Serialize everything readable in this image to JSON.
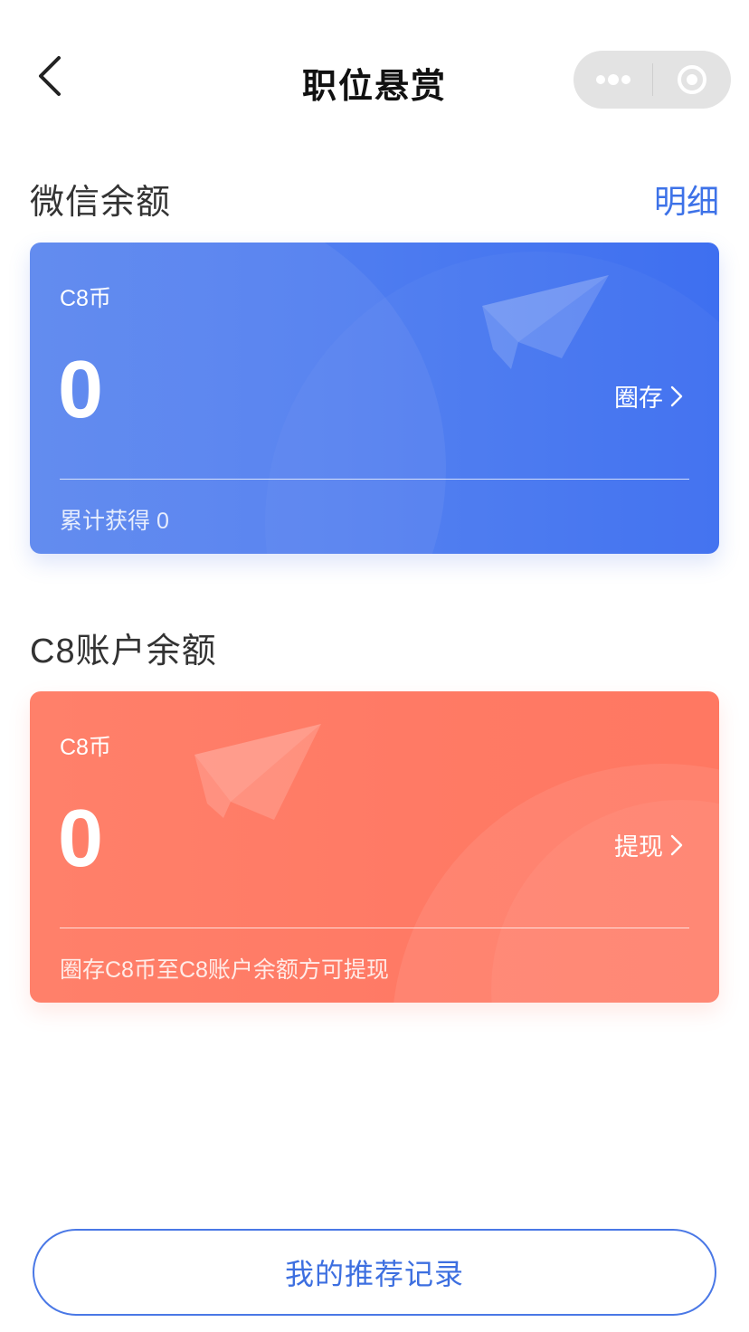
{
  "navbar": {
    "title": "职位悬赏",
    "back_icon": "chevron-left-icon",
    "more_icon": "more-dots-icon",
    "close_icon": "target-close-icon"
  },
  "wechat_section": {
    "title": "微信余额",
    "detail_link": "明细",
    "card": {
      "label": "C8币",
      "amount": "0",
      "action": "圈存",
      "footer": "累计获得 0",
      "color": "#4f7df0"
    }
  },
  "c8_section": {
    "title": "C8账户余额",
    "card": {
      "label": "C8币",
      "amount": "0",
      "action": "提现",
      "footer": "圈存C8币至C8账户余额方可提现",
      "color": "#ff7a65"
    }
  },
  "bottom_button": {
    "label": "我的推荐记录"
  },
  "colors": {
    "accent": "#3d72e8",
    "blue_card": "#4f7df0",
    "orange_card": "#ff7a65"
  }
}
